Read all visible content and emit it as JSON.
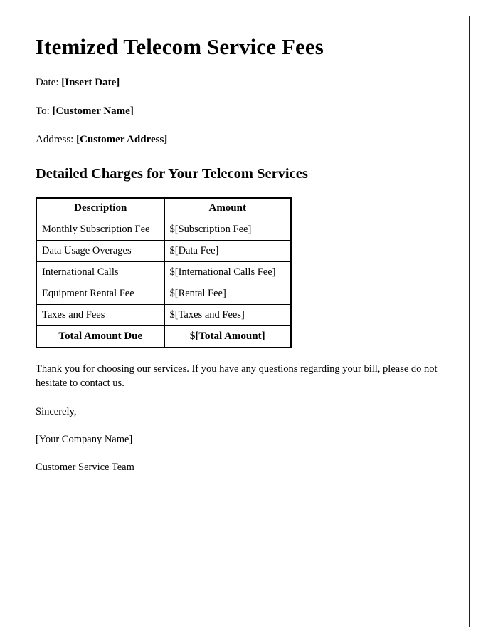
{
  "document": {
    "title": "Itemized Telecom Service Fees",
    "meta": [
      {
        "label": "Date:",
        "value": "[Insert Date]"
      },
      {
        "label": "To:",
        "value": "[Customer Name]"
      },
      {
        "label": "Address:",
        "value": "[Customer Address]"
      }
    ],
    "section_heading": "Detailed Charges for Your Telecom Services",
    "table": {
      "headers": [
        "Description",
        "Amount"
      ],
      "rows": [
        [
          "Monthly Subscription Fee",
          "$[Subscription Fee]"
        ],
        [
          "Data Usage Overages",
          "$[Data Fee]"
        ],
        [
          "International Calls",
          "$[International Calls Fee]"
        ],
        [
          "Equipment Rental Fee",
          "$[Rental Fee]"
        ],
        [
          "Taxes and Fees",
          "$[Taxes and Fees]"
        ]
      ],
      "total_row": [
        "Total Amount Due",
        "$[Total Amount]"
      ]
    },
    "closing_paragraph": "Thank you for choosing our services. If you have any questions regarding your bill, please do not hesitate to contact us.",
    "signature": [
      "Sincerely,",
      "[Your Company Name]",
      "Customer Service Team"
    ]
  }
}
